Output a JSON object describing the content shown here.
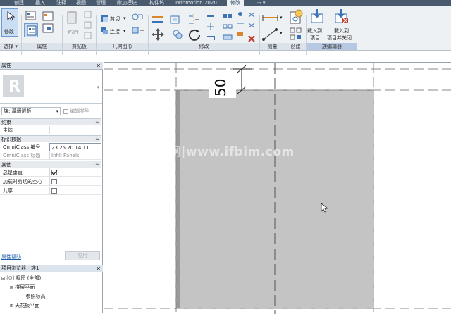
{
  "ribbon_tabs": [
    "创建",
    "插入",
    "注释",
    "视图",
    "管理",
    "附加模块",
    "构件坞",
    "Twinmotion 2020",
    "修改"
  ],
  "active_tab": "修改",
  "ribbon": {
    "modify_label": "修改",
    "clipboard": {
      "paste_label": "粘贴"
    },
    "geometry": {
      "cut_label": "剪切",
      "join_label": "连接"
    },
    "family_editor": {
      "load_label_1": "载入到",
      "load_label_2": "项目",
      "load_close_label_1": "载入到",
      "load_close_label_2": "项目并关闭"
    },
    "panels": [
      "选择",
      "属性",
      "剪贴板",
      "几何图形",
      "修改",
      "测量",
      "创建",
      "族编辑器"
    ]
  },
  "properties": {
    "header": "属性",
    "family_type": "族: 幕墙嵌板",
    "edit_type_label": "编辑类型",
    "sections": {
      "constraints": "约束",
      "identity": "标识数据",
      "other": "其他"
    },
    "rows": {
      "host": {
        "key": "主体",
        "value": ""
      },
      "omniclass_number": {
        "key": "OmniClass 编号",
        "value": "23.25.20.14.11..."
      },
      "omniclass_title": {
        "key": "OmniClass 标题",
        "value": "Infill Panels"
      },
      "always_vertical": {
        "key": "总是垂直",
        "checked": true
      },
      "cut_with_voids": {
        "key": "加载时剪切的空心",
        "checked": false
      },
      "shared": {
        "key": "共享",
        "checked": false
      }
    },
    "help_link": "属性帮助",
    "apply_label": "应用"
  },
  "project_browser": {
    "header": "项目浏览器 - 族1",
    "items": [
      "视图 (全部)",
      "楼层平面",
      "参照标高",
      "天花板平面"
    ]
  },
  "canvas": {
    "dimension_value": "50",
    "watermark": "BIM教程网|www.ifbim.com"
  },
  "colors": {
    "panel_fill": "#c4c4c4",
    "tab_bar": "#4a5a6e",
    "ribbon_bg": "#eef1f4",
    "selection_blue": "#c9ddf3"
  }
}
